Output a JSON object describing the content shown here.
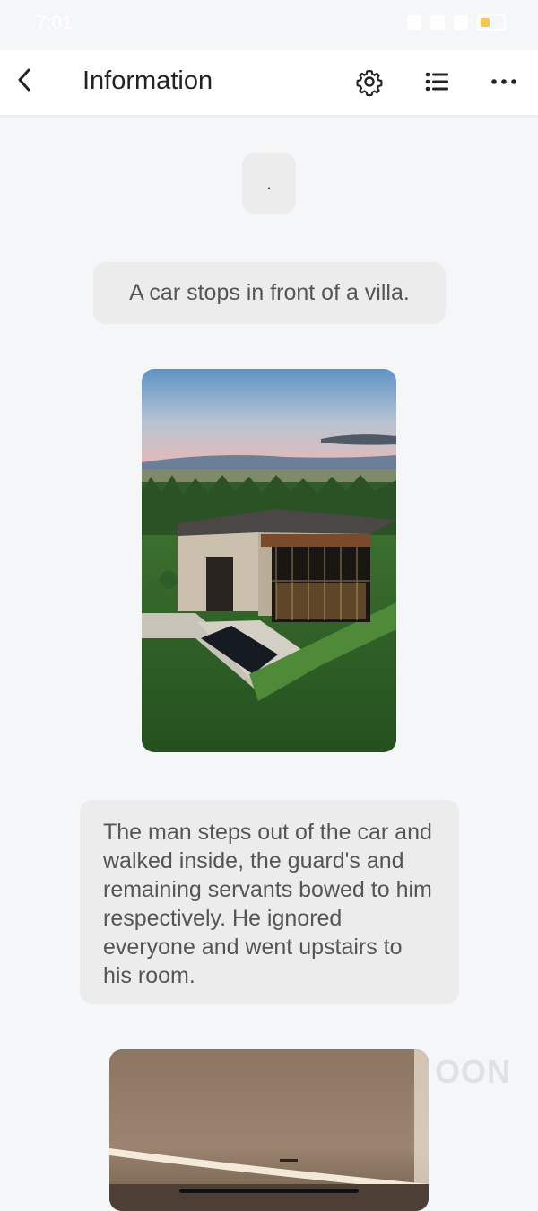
{
  "status_bar": {
    "time": "7:01"
  },
  "header": {
    "title": "Information",
    "back_icon": "chevron-left-icon",
    "settings_icon": "gear-icon",
    "list_icon": "list-icon",
    "more_icon": "more-horizontal-icon"
  },
  "messages": [
    {
      "type": "text",
      "text": "."
    },
    {
      "type": "text",
      "text": "A car stops in front of a villa."
    },
    {
      "type": "image",
      "subject": "modern villa at dusk"
    },
    {
      "type": "text",
      "text": "The man steps out of the car and walked inside, the guard's and remaining servants bowed to him respectively. He ignored everyone and went upstairs to his room."
    },
    {
      "type": "image",
      "subject": "interior ceiling"
    }
  ],
  "watermark": "OON",
  "colors": {
    "background": "#f5f6f8",
    "bubble": "#ececec",
    "bubble_text": "#555555",
    "header": "#ffffff",
    "battery_fill": "#f5c84c"
  }
}
